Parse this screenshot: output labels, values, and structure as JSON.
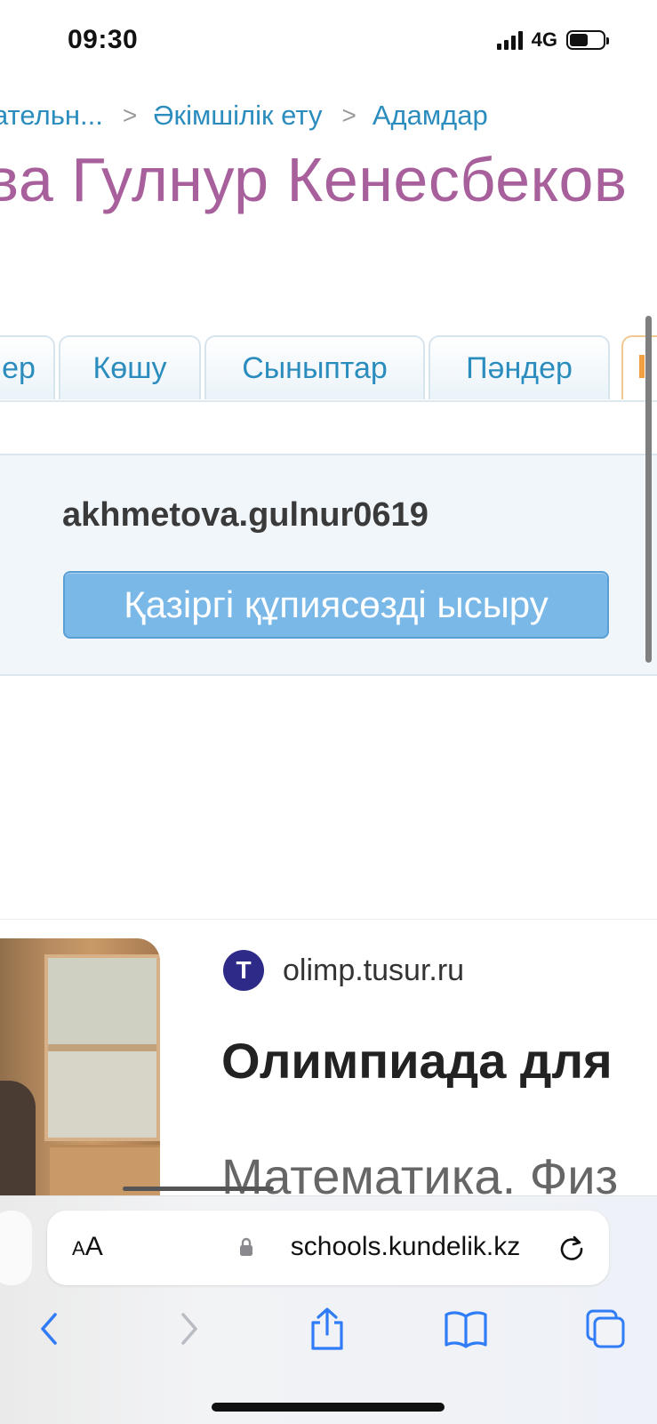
{
  "status_bar": {
    "time": "09:30",
    "network": "4G",
    "battery_level": 0.55
  },
  "breadcrumb": {
    "items": [
      "ательн...",
      "Әкімшілік ету",
      "Адамдар"
    ],
    "separator": ">"
  },
  "page_title": "ва Гулнур Кенесбеков",
  "tabs": [
    {
      "label": "ер"
    },
    {
      "label": "Көшу"
    },
    {
      "label": "Сыныптар"
    },
    {
      "label": "Пәндер"
    }
  ],
  "account": {
    "username": "akhmetova.gulnur0619",
    "reset_button_label": "Қазіргі құпиясөзді ысыру"
  },
  "ad": {
    "logo_letter": "T",
    "domain": "olimp.tusur.ru",
    "headline": "Олимпиада для",
    "body": "Математика. Физ"
  },
  "browser": {
    "text_size_label_small": "A",
    "text_size_label_large": "A",
    "url": "schools.kundelik.kz"
  },
  "colors": {
    "link": "#2b8cbe",
    "title": "#a8609c",
    "button": "#7ab8e8",
    "ios_blue": "#2f7cf6"
  }
}
